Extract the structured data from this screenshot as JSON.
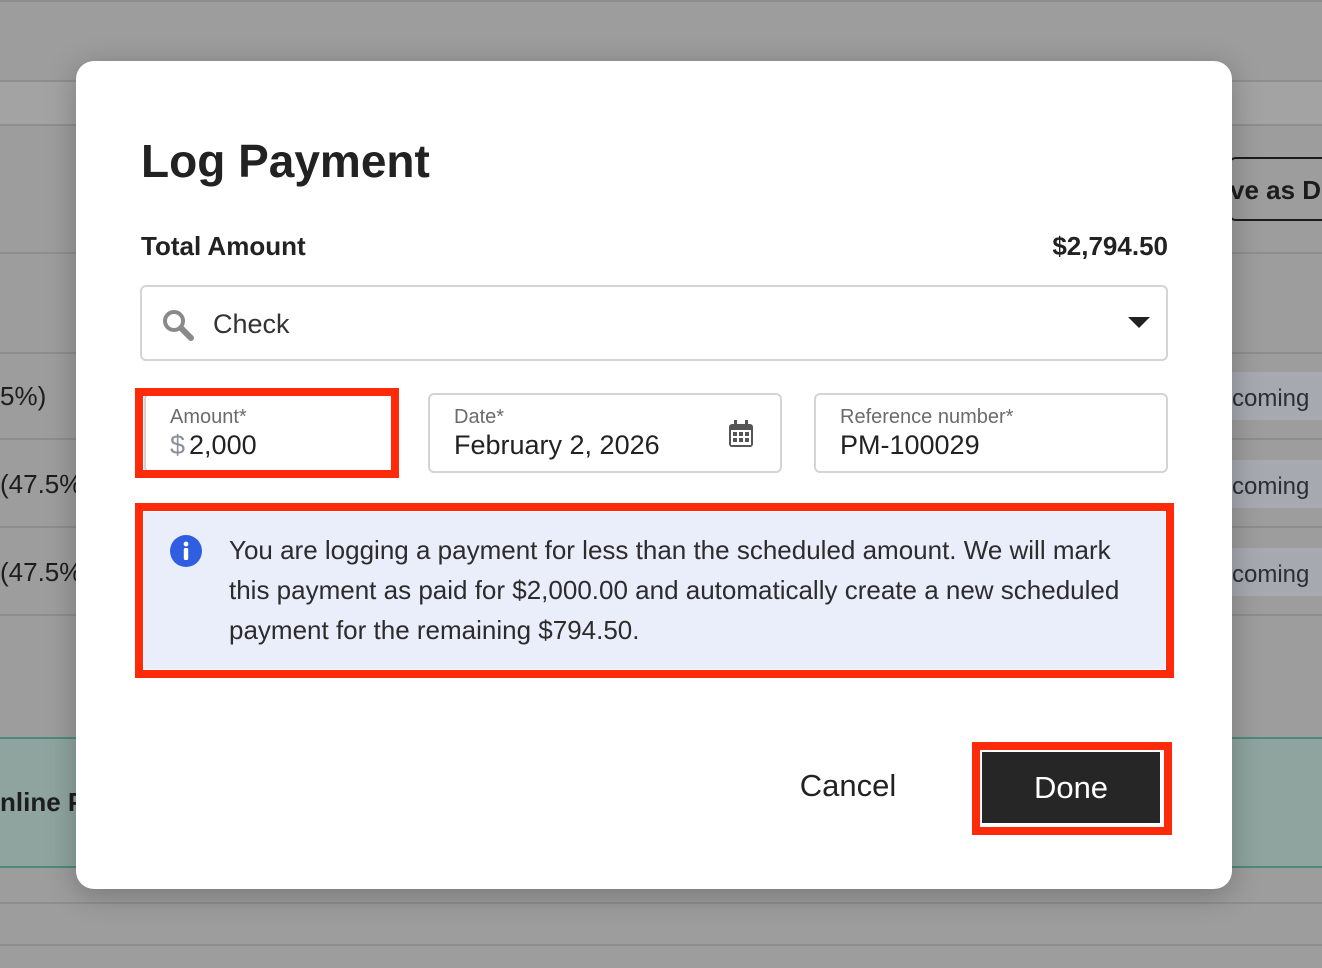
{
  "background": {
    "row_texts": [
      "5%)",
      "(47.5%",
      "(47.5%"
    ],
    "status_pills": [
      "coming",
      "coming",
      "coming"
    ],
    "save_button_partial": "ve as De",
    "online_label_partial": "nline P"
  },
  "modal": {
    "title": "Log Payment",
    "total_label": "Total Amount",
    "total_value": "$2,794.50",
    "method_select": {
      "value": "Check",
      "icon": "search-icon"
    },
    "amount": {
      "label": "Amount*",
      "currency": "$",
      "value": "2,000"
    },
    "date": {
      "label": "Date*",
      "value": "February 2, 2026",
      "icon": "calendar-icon"
    },
    "reference": {
      "label": "Reference number*",
      "value": "PM-100029"
    },
    "info_message": "You are logging a payment for less than the scheduled amount. We will mark this payment as paid for $2,000.00 and automatically create a new scheduled payment for the remaining $794.50.",
    "cancel_label": "Cancel",
    "done_label": "Done"
  },
  "colors": {
    "highlight": "#ff2a0a",
    "info_bg": "#eaedfa",
    "info_icon": "#2f5fe0",
    "done_bg": "#262626"
  }
}
